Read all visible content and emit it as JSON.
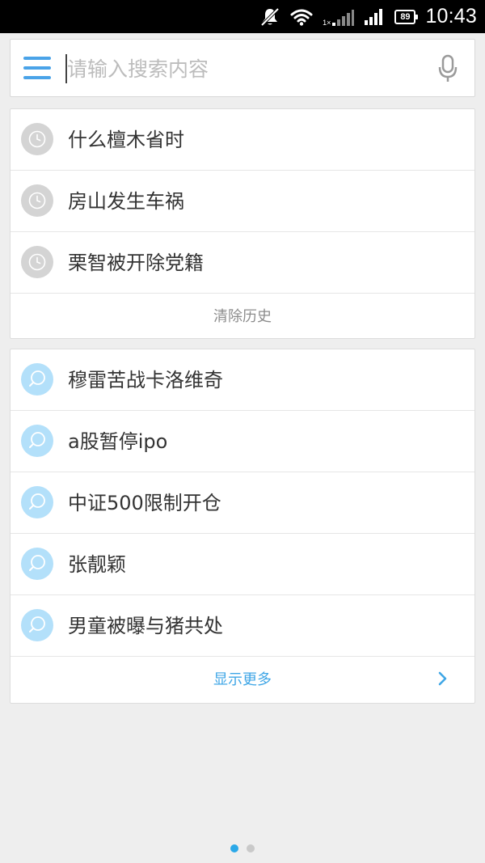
{
  "status_bar": {
    "time": "10:43",
    "battery_level": "89",
    "network_label": "1×",
    "icons": [
      "mute-icon",
      "wifi-icon",
      "signal-1x-icon",
      "signal-icon",
      "battery-icon"
    ]
  },
  "search": {
    "placeholder": "请输入搜索内容",
    "value": "",
    "menu_icon": "menu-icon",
    "mic_icon": "microphone-icon"
  },
  "history": {
    "items": [
      {
        "label": "什么檀木省时",
        "icon": "clock-icon"
      },
      {
        "label": "房山发生车祸",
        "icon": "clock-icon"
      },
      {
        "label": "栗智被开除党籍",
        "icon": "clock-icon"
      }
    ],
    "clear_label": "清除历史"
  },
  "suggestions": {
    "items": [
      {
        "label": "穆雷苦战卡洛维奇",
        "icon": "search-bubble-icon"
      },
      {
        "label": "a股暂停ipo",
        "icon": "search-bubble-icon"
      },
      {
        "label": "中证500限制开仓",
        "icon": "search-bubble-icon"
      },
      {
        "label": "张靓颖",
        "icon": "search-bubble-icon"
      },
      {
        "label": "男童被曝与猪共处",
        "icon": "search-bubble-icon"
      }
    ],
    "more_label": "显示更多"
  },
  "page_indicator": {
    "count": 2,
    "active_index": 0
  },
  "colors": {
    "accent": "#4aa3e8",
    "link": "#3fa6e6",
    "history_icon_bg": "#d4d4d4",
    "suggest_icon_bg": "#b3e0fa",
    "background": "#eeeeee"
  }
}
